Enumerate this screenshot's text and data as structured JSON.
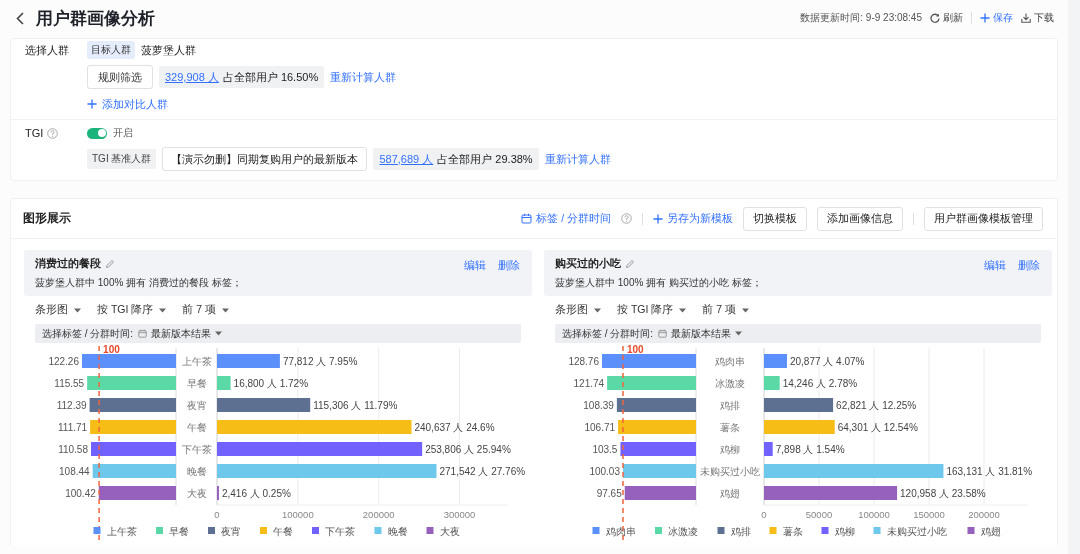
{
  "header": {
    "title": "用户群画像分析",
    "update_time": "数据更新时间: 9-9 23:08:45",
    "actions": [
      {
        "kind": "refresh",
        "label": "刷新"
      },
      {
        "kind": "save",
        "label": "保存"
      },
      {
        "kind": "download",
        "label": "下载"
      }
    ]
  },
  "crowd": {
    "label": "选择人群",
    "target_tag": "目标人群",
    "target_name": "菠萝堡人群",
    "rule_button": "规则筛选",
    "count_link": "329,908 人",
    "share": "占全部用户 16.50%",
    "recalc": "重新计算人群",
    "add_compare": "添加对比人群"
  },
  "tgi": {
    "label": "TGI",
    "on": true,
    "switch_label": "开启",
    "base_tag": "TGI 基准人群",
    "base_name": "【演示勿删】同期复购用户的最新版本",
    "count_link": "587,689 人",
    "share": "占全部用户 29.38%",
    "recalc": "重新计算人群"
  },
  "graphics": {
    "title": "图形展示",
    "toolbar": [
      {
        "kind": "calendar-link",
        "label": "标签 / 分群时间",
        "help": true,
        "divider_before": false
      },
      {
        "kind": "plus-link",
        "label": "另存为新模板",
        "help": false,
        "divider_before": true
      },
      {
        "kind": "button",
        "label": "切换模板",
        "help": false,
        "divider_before": false
      },
      {
        "kind": "button",
        "label": "添加画像信息",
        "help": false,
        "divider_before": false
      },
      {
        "kind": "button",
        "label": "用户群画像模板管理",
        "help": false,
        "divider_before": true
      }
    ],
    "panels": [
      {
        "title": "消费过的餐段",
        "description": "菠萝堡人群中 100% 拥有 消费过的餐段 标签；",
        "actions": [
          "编辑",
          "删除"
        ],
        "dropdowns": [
          "条形图",
          "按 TGI 降序",
          "前 7 项"
        ],
        "filter_label": "选择标签 / 分群时间:",
        "filter_value": "最新版本结果",
        "tgi_labels": [
          "122.26",
          "115.55",
          "112.39",
          "111.71",
          "110.58",
          "108.44",
          "100.42"
        ],
        "tgi_reference_label": "100",
        "count_chart": {
          "chart_data": {
            "type": "bar",
            "orientation": "horizontal",
            "categories": [
              "上午茶",
              "早餐",
              "夜宵",
              "午餐",
              "下午茶",
              "晚餐",
              "大夜"
            ],
            "series": [
              {
                "colors": [
                  "#5b8ff9",
                  "#5ad8a6",
                  "#5d7092",
                  "#f6bd16",
                  "#7262fd",
                  "#6dc8ec",
                  "#9661bc"
                ],
                "values": [
                  77812,
                  16800,
                  115306,
                  240637,
                  253806,
                  271542,
                  2416
                ]
              }
            ],
            "value_labels": [
              "77,812 人 7.95%",
              "16,800 人 1.72%",
              "115,306 人 11.79%",
              "240,637 人 24.6%",
              "253,806 人 25.94%",
              "271,542 人 27.76%",
              "2,416 人 0.25%"
            ],
            "grid": true,
            "xlim": [
              0,
              360000
            ],
            "xticks": [
              0,
              100000,
              200000,
              300000
            ]
          }
        },
        "legend": [
          {
            "label": "上午茶",
            "color": "#5b8ff9"
          },
          {
            "label": "早餐",
            "color": "#5ad8a6"
          },
          {
            "label": "夜宵",
            "color": "#5d7092"
          },
          {
            "label": "午餐",
            "color": "#f6bd16"
          },
          {
            "label": "下午茶",
            "color": "#7262fd"
          },
          {
            "label": "晚餐",
            "color": "#6dc8ec"
          },
          {
            "label": "大夜",
            "color": "#9661bc"
          }
        ]
      },
      {
        "title": "购买过的小吃",
        "description": "菠萝堡人群中 100% 拥有 购买过的小吃 标签；",
        "actions": [
          "编辑",
          "删除"
        ],
        "dropdowns": [
          "条形图",
          "按 TGI 降序",
          "前 7 项"
        ],
        "filter_label": "选择标签 / 分群时间:",
        "filter_value": "最新版本结果",
        "tgi_labels": [
          "128.76",
          "121.74",
          "108.39",
          "106.71",
          "103.5",
          "100.03",
          "97.65"
        ],
        "tgi_reference_label": "100",
        "count_chart": {
          "chart_data": {
            "type": "bar",
            "orientation": "horizontal",
            "categories": [
              "鸡肉串",
              "冰激凌",
              "鸡排",
              "薯条",
              "鸡柳",
              "未购买过小吃",
              "鸡翅"
            ],
            "series": [
              {
                "colors": [
                  "#5b8ff9",
                  "#5ad8a6",
                  "#5d7092",
                  "#f6bd16",
                  "#7262fd",
                  "#6dc8ec",
                  "#9661bc"
                ],
                "values": [
                  20877,
                  14246,
                  62821,
                  64301,
                  7898,
                  163131,
                  120958
                ]
              }
            ],
            "value_labels": [
              "20,877 人 4.07%",
              "14,246 人 2.78%",
              "62,821 人 12.25%",
              "64,301 人 12.54%",
              "7,898 人 1.54%",
              "163,131 人 31.81%",
              "120,958 人 23.58%"
            ],
            "grid": true,
            "xlim": [
              0,
              240000
            ],
            "xticks": [
              0,
              50000,
              100000,
              150000,
              200000
            ]
          }
        },
        "legend": [
          {
            "label": "鸡肉串",
            "color": "#5b8ff9"
          },
          {
            "label": "冰激凌",
            "color": "#5ad8a6"
          },
          {
            "label": "鸡排",
            "color": "#5d7092"
          },
          {
            "label": "薯条",
            "color": "#f6bd16"
          },
          {
            "label": "鸡柳",
            "color": "#7262fd"
          },
          {
            "label": "未购买过小吃",
            "color": "#6dc8ec"
          },
          {
            "label": "鸡翅",
            "color": "#9661bc"
          }
        ]
      }
    ]
  }
}
